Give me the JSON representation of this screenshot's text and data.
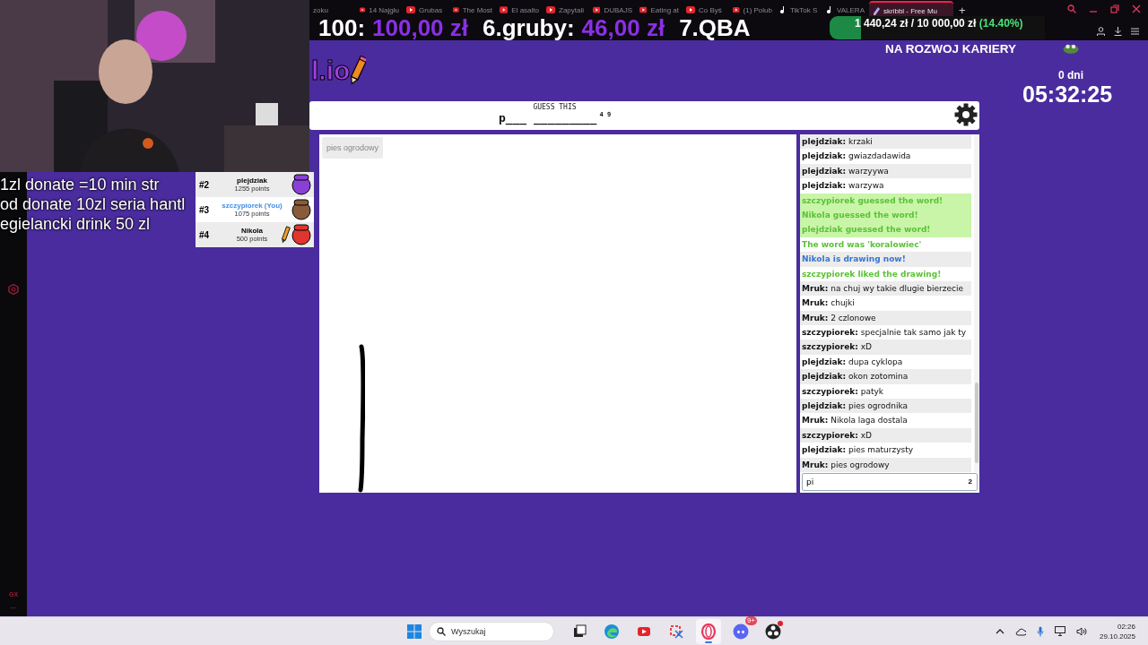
{
  "browser": {
    "tabs": [
      {
        "label": "zoku",
        "kind": "plain",
        "selected": false
      },
      {
        "label": "14 Najgłu",
        "kind": "video",
        "selected": false
      },
      {
        "label": "Grubas",
        "kind": "video",
        "selected": false
      },
      {
        "label": "The Most",
        "kind": "video",
        "selected": false
      },
      {
        "label": "El asalto",
        "kind": "video",
        "selected": false
      },
      {
        "label": "Zapytali",
        "kind": "video",
        "selected": false
      },
      {
        "label": "DUBAJS",
        "kind": "video",
        "selected": false
      },
      {
        "label": "Eating at",
        "kind": "video",
        "selected": false
      },
      {
        "label": "Co Byś",
        "kind": "video",
        "selected": false
      },
      {
        "label": "(1) Polub",
        "kind": "video",
        "selected": false
      },
      {
        "label": "TikTok S",
        "kind": "music",
        "selected": false
      },
      {
        "label": "VALERA",
        "kind": "music",
        "selected": false
      },
      {
        "label": "skribbl - Free Mu",
        "kind": "game",
        "selected": true
      }
    ],
    "new_tab": "+"
  },
  "sidebar": {
    "labels": [
      "GX",
      "···"
    ]
  },
  "stream_overlay": {
    "ranking": [
      {
        "place": "100:",
        "amount": "100,00 zł"
      },
      {
        "place": "6.gruby:",
        "amount": "46,00 zł"
      },
      {
        "place": "7.QBA"
      }
    ],
    "goal": {
      "amounts": "1 440,24 zł / 10 000,00 zł",
      "percent": "(14.40%)",
      "level": 0.144,
      "title": "NA ROZWOJ KARIERY"
    },
    "timer": {
      "days": "0 dni",
      "time": "05:32:25"
    },
    "info_lines": [
      "1zl donate =10 min str",
      "od donate 10zl seria hantl",
      "egielancki drink 50 zl"
    ]
  },
  "game": {
    "logo": "l.io",
    "hint_label": "GUESS THIS",
    "word": "p___ _________",
    "word_lengths": "4 9",
    "players": [
      {
        "rank": "#2",
        "name": "plejdziak",
        "points": "1255 points",
        "you": false,
        "drawing": false,
        "color": "#8a3fd6"
      },
      {
        "rank": "#3",
        "name": "szczypiorek (You)",
        "points": "1075 points",
        "you": true,
        "drawing": false,
        "color": "#8a5a3c"
      },
      {
        "rank": "#4",
        "name": "Nikola",
        "points": "500 points",
        "you": false,
        "drawing": true,
        "color": "#e0352f"
      }
    ],
    "canvas": {
      "tooltip": "pies ogrodowy"
    },
    "chat": {
      "messages": [
        {
          "kind": "message",
          "text": "**plejdziak:** krzaki"
        },
        {
          "kind": "message",
          "text": "**plejdziak:** gwiazdadawida"
        },
        {
          "kind": "message",
          "text": "**plejdziak:** warzyywa"
        },
        {
          "kind": "message",
          "text": "**plejdziak:** warzywa"
        },
        {
          "kind": "notice",
          "text": "szczypiorek guessed the word!",
          "color": "#5bc236",
          "highlight": true
        },
        {
          "kind": "notice",
          "text": "Nikola guessed the word!",
          "color": "#5bc236",
          "highlight": true
        },
        {
          "kind": "notice",
          "text": "plejdziak guessed the word!",
          "color": "#5bc236",
          "highlight": true
        },
        {
          "kind": "notice",
          "text": "The word was 'koralowiec'",
          "color": "#5bc236",
          "highlight": false
        },
        {
          "kind": "notice",
          "text": "Nikola is drawing now!",
          "color": "#3975ce",
          "highlight": false
        },
        {
          "kind": "notice",
          "text": "szczypiorek liked the drawing!",
          "color": "#5bc236",
          "highlight": false
        },
        {
          "kind": "message",
          "text": "**Mruk:** na chuj wy takie dlugie bierzecie"
        },
        {
          "kind": "message",
          "text": "**Mruk:** chujki"
        },
        {
          "kind": "message",
          "text": "**Mruk:** 2 czlonowe"
        },
        {
          "kind": "message",
          "text": "**szczypiorek:** specjalnie tak samo jak ty"
        },
        {
          "kind": "message",
          "text": "**szczypiorek:** xD"
        },
        {
          "kind": "message",
          "text": "**plejdziak:** dupa cyklopa"
        },
        {
          "kind": "message",
          "text": "**plejdziak:** okon zotomina"
        },
        {
          "kind": "message",
          "text": "**szczypiorek:** patyk"
        },
        {
          "kind": "message",
          "text": "**plejdziak:** pies ogrodnika"
        },
        {
          "kind": "message",
          "text": "**Mruk:** Nikola laga dostala"
        },
        {
          "kind": "message",
          "text": "**szczypiorek:** xD"
        },
        {
          "kind": "message",
          "text": "**plejdziak:** pies maturzysty"
        },
        {
          "kind": "message",
          "text": "**Mruk:** pies ogrodowy"
        }
      ],
      "input": {
        "value": "pi",
        "counter": "2"
      }
    }
  },
  "taskbar": {
    "search": {
      "placeholder": "Wyszukaj"
    },
    "apps": [
      {
        "kind": "taskview",
        "selected": false,
        "alert": false
      },
      {
        "kind": "edge",
        "selected": false,
        "alert": false
      },
      {
        "kind": "youtube",
        "selected": false,
        "alert": false
      },
      {
        "kind": "snip",
        "selected": false,
        "alert": false
      },
      {
        "kind": "opera",
        "selected": true,
        "alert": false
      },
      {
        "kind": "discord",
        "selected": false,
        "alert": false,
        "badge": "9+"
      },
      {
        "kind": "obs",
        "selected": false,
        "alert": true
      }
    ],
    "time": "02:26",
    "date": "29.10.2025"
  }
}
